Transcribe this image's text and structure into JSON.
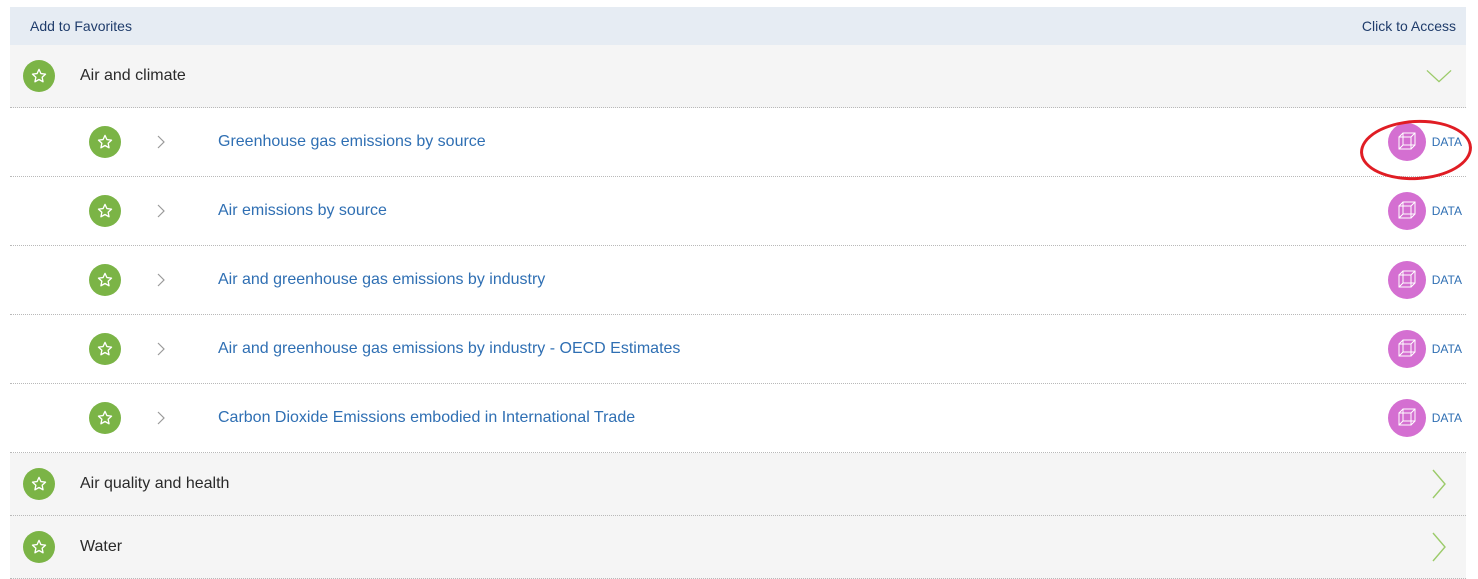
{
  "header": {
    "left_label": "Add to Favorites",
    "right_label": "Click to Access"
  },
  "categories": [
    {
      "label": "Air and climate",
      "expanded": true,
      "items": [
        {
          "label": "Greenhouse gas emissions by source",
          "access_label": "DATA"
        },
        {
          "label": "Air emissions by source",
          "access_label": "DATA"
        },
        {
          "label": "Air and greenhouse gas emissions by industry",
          "access_label": "DATA"
        },
        {
          "label": "Air and greenhouse gas emissions by industry - OECD Estimates",
          "access_label": "DATA"
        },
        {
          "label": "Carbon Dioxide Emissions embodied in International Trade",
          "access_label": "DATA"
        }
      ]
    },
    {
      "label": "Air quality and health",
      "expanded": false,
      "items": []
    },
    {
      "label": "Water",
      "expanded": false,
      "items": []
    }
  ],
  "colors": {
    "star_badge": "#7bb446",
    "data_badge": "#d46fd1",
    "link_text": "#2f6fb3",
    "header_bg": "#e6ecf3",
    "highlight": "#e01d24"
  },
  "icons": {
    "favorite": "star-icon",
    "access": "cube-icon",
    "expand": "chevron-down-icon",
    "collapse": "chevron-right-icon"
  }
}
